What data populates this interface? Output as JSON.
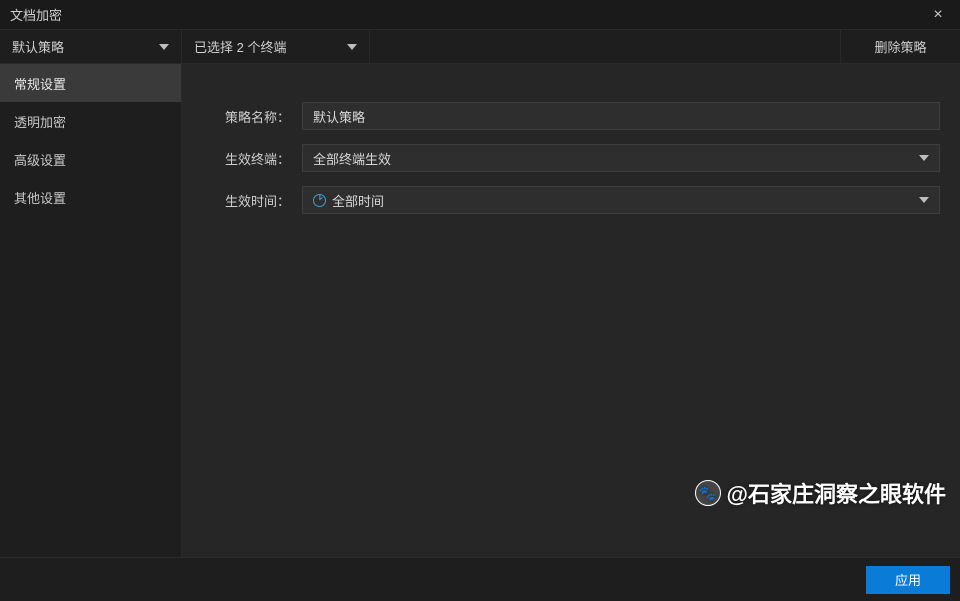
{
  "window": {
    "title": "文档加密",
    "close_label": "×"
  },
  "toolbar": {
    "policy_dropdown": "默认策略",
    "terminal_dropdown": "已选择 2 个终端",
    "delete_label": "删除策略"
  },
  "sidebar": {
    "items": [
      {
        "label": "常规设置",
        "active": true
      },
      {
        "label": "透明加密",
        "active": false
      },
      {
        "label": "高级设置",
        "active": false
      },
      {
        "label": "其他设置",
        "active": false
      }
    ]
  },
  "form": {
    "policy_name_label": "策略名称：",
    "policy_name_value": "默认策略",
    "terminal_label": "生效终端：",
    "terminal_value": "全部终端生效",
    "time_label": "生效时间：",
    "time_value": "全部时间"
  },
  "bottom": {
    "apply_label": "应用"
  },
  "watermark": {
    "text": "@石家庄洞察之眼软件",
    "icon": "🐾"
  }
}
